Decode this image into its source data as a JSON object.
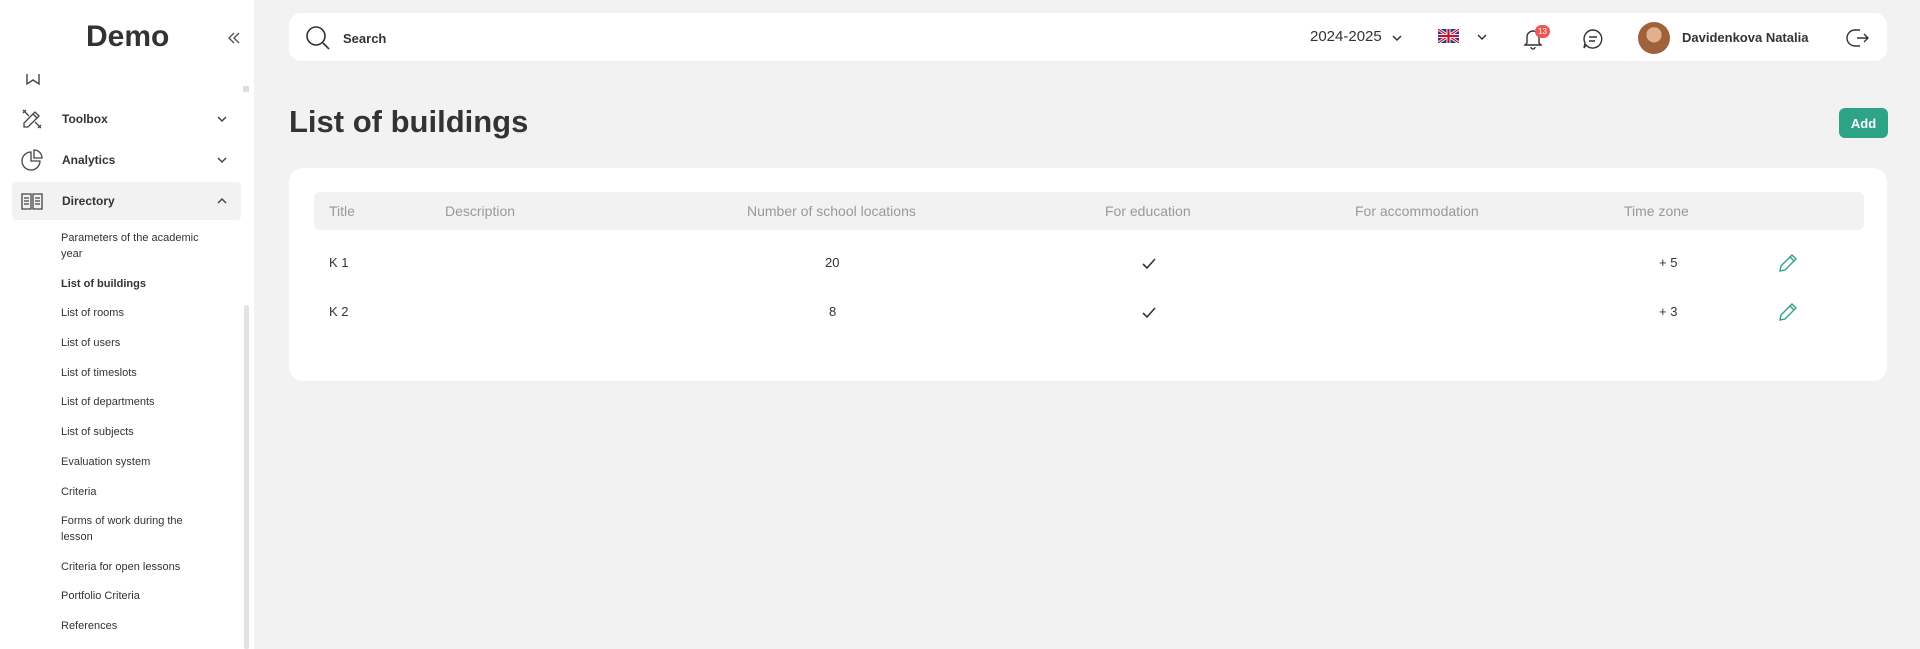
{
  "sidebar": {
    "logo": "Demo",
    "items": [
      {
        "label": "Toolbox"
      },
      {
        "label": "Analytics"
      },
      {
        "label": "Directory"
      }
    ],
    "subitems": [
      {
        "label": "Parameters of the academic year"
      },
      {
        "label": "List of buildings"
      },
      {
        "label": "List of rooms"
      },
      {
        "label": "List of users"
      },
      {
        "label": "List of timeslots"
      },
      {
        "label": "List of departments"
      },
      {
        "label": "List of subjects"
      },
      {
        "label": "Evaluation system"
      },
      {
        "label": "Criteria"
      },
      {
        "label": "Forms of work during the lesson"
      },
      {
        "label": "Criteria for open lessons"
      },
      {
        "label": "Portfolio Criteria"
      },
      {
        "label": "References"
      }
    ]
  },
  "topbar": {
    "search_placeholder": "Search",
    "year": "2024-2025",
    "notifications_count": "13",
    "user_name": "Davidenkova Natalia"
  },
  "main": {
    "title": "List of buildings",
    "add_label": "Add"
  },
  "table": {
    "columns": [
      "Title",
      "Description",
      "Number of school locations",
      "For education",
      "For accommodation",
      "Time zone"
    ],
    "rows": [
      {
        "title": "K 1",
        "description": "",
        "locations": "20",
        "for_education": true,
        "for_accommodation": false,
        "timezone": "+ 5"
      },
      {
        "title": "K 2",
        "description": "",
        "locations": "8",
        "for_education": true,
        "for_accommodation": false,
        "timezone": "+ 3"
      }
    ]
  },
  "colors": {
    "accent": "#2ea387",
    "badge": "#e55555"
  }
}
